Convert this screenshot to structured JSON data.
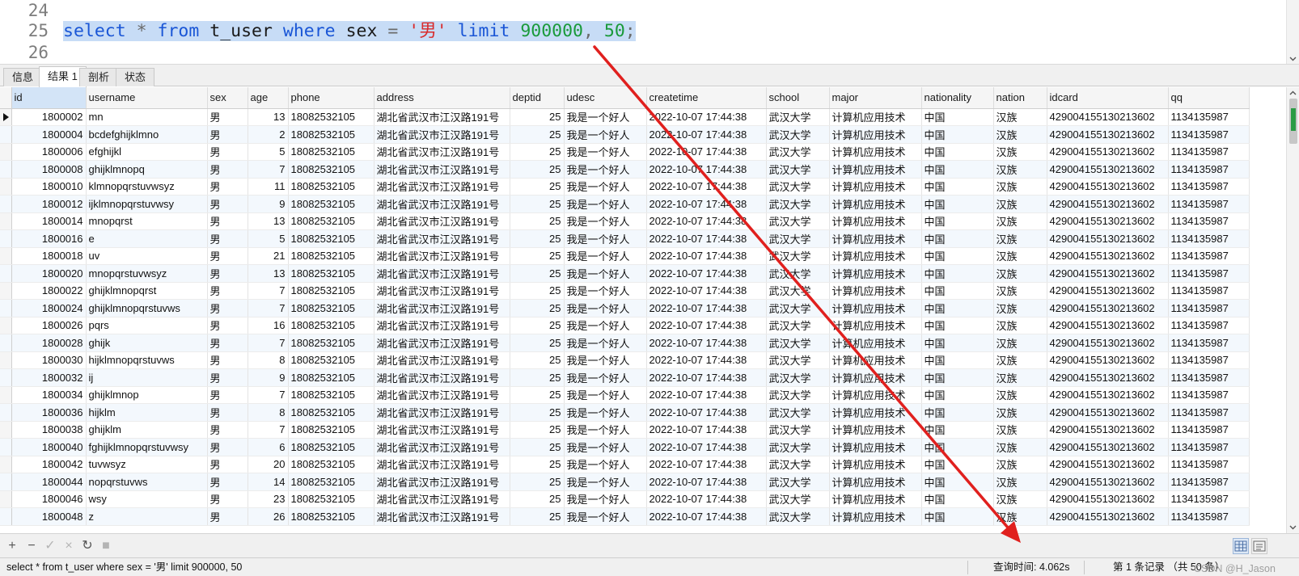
{
  "editor": {
    "lines": [
      {
        "number": "24",
        "tokens": []
      },
      {
        "number": "25",
        "tokens": [
          {
            "text": "select",
            "cls": "kw"
          },
          {
            "text": " ",
            "cls": "op"
          },
          {
            "text": "*",
            "cls": "op"
          },
          {
            "text": " ",
            "cls": "op"
          },
          {
            "text": "from",
            "cls": "kw"
          },
          {
            "text": " ",
            "cls": "op"
          },
          {
            "text": "t_user",
            "cls": "ident"
          },
          {
            "text": " ",
            "cls": "op"
          },
          {
            "text": "where",
            "cls": "kw"
          },
          {
            "text": " ",
            "cls": "op"
          },
          {
            "text": "sex",
            "cls": "ident"
          },
          {
            "text": " ",
            "cls": "op"
          },
          {
            "text": "=",
            "cls": "op"
          },
          {
            "text": " ",
            "cls": "op"
          },
          {
            "text": "'男'",
            "cls": "str"
          },
          {
            "text": " ",
            "cls": "op"
          },
          {
            "text": "limit",
            "cls": "kw"
          },
          {
            "text": " ",
            "cls": "op"
          },
          {
            "text": "900000",
            "cls": "num"
          },
          {
            "text": ",",
            "cls": "op"
          },
          {
            "text": " ",
            "cls": "op"
          },
          {
            "text": "50",
            "cls": "num"
          },
          {
            "text": ";",
            "cls": "op"
          }
        ]
      },
      {
        "number": "26",
        "tokens": []
      }
    ]
  },
  "tabs": [
    {
      "label": "信息",
      "active": false
    },
    {
      "label": "结果 1",
      "active": true
    },
    {
      "label": "剖析",
      "active": false
    },
    {
      "label": "状态",
      "active": false
    }
  ],
  "grid": {
    "columns": [
      {
        "name": "id",
        "align": "right"
      },
      {
        "name": "username",
        "align": "left"
      },
      {
        "name": "sex",
        "align": "left"
      },
      {
        "name": "age",
        "align": "right"
      },
      {
        "name": "phone",
        "align": "left"
      },
      {
        "name": "address",
        "align": "left"
      },
      {
        "name": "deptid",
        "align": "right"
      },
      {
        "name": "udesc",
        "align": "left"
      },
      {
        "name": "createtime",
        "align": "left"
      },
      {
        "name": "school",
        "align": "left"
      },
      {
        "name": "major",
        "align": "left"
      },
      {
        "name": "nationality",
        "align": "left"
      },
      {
        "name": "nation",
        "align": "left"
      },
      {
        "name": "idcard",
        "align": "left"
      },
      {
        "name": "qq",
        "align": "left"
      }
    ],
    "row_constant": {
      "sex": "男",
      "phone": "18082532105",
      "address": "湖北省武汉市江汉路191号",
      "deptid": "25",
      "udesc": "我是一个好人",
      "createtime": "2022-10-07 17:44:38",
      "school": "武汉大学",
      "major": "计算机应用技术",
      "nationality": "中国",
      "nation": "汉族",
      "idcard": "429004155130213602",
      "qq": "1134135987"
    },
    "rows": [
      {
        "id": "1800002",
        "username": "mn",
        "age": "13"
      },
      {
        "id": "1800004",
        "username": "bcdefghijklmno",
        "age": "2"
      },
      {
        "id": "1800006",
        "username": "efghijkl",
        "age": "5"
      },
      {
        "id": "1800008",
        "username": "ghijklmnopq",
        "age": "7"
      },
      {
        "id": "1800010",
        "username": "klmnopqrstuvwsyz",
        "age": "11"
      },
      {
        "id": "1800012",
        "username": "ijklmnopqrstuvwsy",
        "age": "9"
      },
      {
        "id": "1800014",
        "username": "mnopqrst",
        "age": "13"
      },
      {
        "id": "1800016",
        "username": "e",
        "age": "5"
      },
      {
        "id": "1800018",
        "username": "uv",
        "age": "21"
      },
      {
        "id": "1800020",
        "username": "mnopqrstuvwsyz",
        "age": "13"
      },
      {
        "id": "1800022",
        "username": "ghijklmnopqrst",
        "age": "7"
      },
      {
        "id": "1800024",
        "username": "ghijklmnopqrstuvws",
        "age": "7"
      },
      {
        "id": "1800026",
        "username": "pqrs",
        "age": "16"
      },
      {
        "id": "1800028",
        "username": "ghijk",
        "age": "7"
      },
      {
        "id": "1800030",
        "username": "hijklmnopqrstuvws",
        "age": "8"
      },
      {
        "id": "1800032",
        "username": "ij",
        "age": "9"
      },
      {
        "id": "1800034",
        "username": "ghijklmnop",
        "age": "7"
      },
      {
        "id": "1800036",
        "username": "hijklm",
        "age": "8"
      },
      {
        "id": "1800038",
        "username": "ghijklm",
        "age": "7"
      },
      {
        "id": "1800040",
        "username": "fghijklmnopqrstuvwsy",
        "age": "6"
      },
      {
        "id": "1800042",
        "username": "tuvwsyz",
        "age": "20"
      },
      {
        "id": "1800044",
        "username": "nopqrstuvws",
        "age": "14"
      },
      {
        "id": "1800046",
        "username": "wsy",
        "age": "23"
      },
      {
        "id": "1800048",
        "username": "z",
        "age": "26"
      }
    ]
  },
  "toolbar": {
    "buttons": [
      {
        "name": "add-record-button",
        "glyph": "+",
        "enabled": true
      },
      {
        "name": "delete-record-button",
        "glyph": "−",
        "enabled": true
      },
      {
        "name": "apply-changes-button",
        "glyph": "✓",
        "enabled": false
      },
      {
        "name": "discard-changes-button",
        "glyph": "×",
        "enabled": false
      },
      {
        "name": "refresh-button",
        "glyph": "↻",
        "enabled": true
      },
      {
        "name": "stop-button",
        "glyph": "■",
        "enabled": false
      }
    ]
  },
  "status": {
    "sql": "select * from t_user where sex = '男' limit 900000, 50",
    "query_time": "查询时间: 4.062s",
    "records": "第 1 条记录 （共 50 条）",
    "watermark": "CSDN @H_Jason"
  },
  "colors": {
    "annotation_arrow": "#e0201e",
    "selection": "#c7dcf6",
    "keyword": "#1a56d6",
    "number": "#1a9a3a",
    "string": "#d92a2a"
  }
}
